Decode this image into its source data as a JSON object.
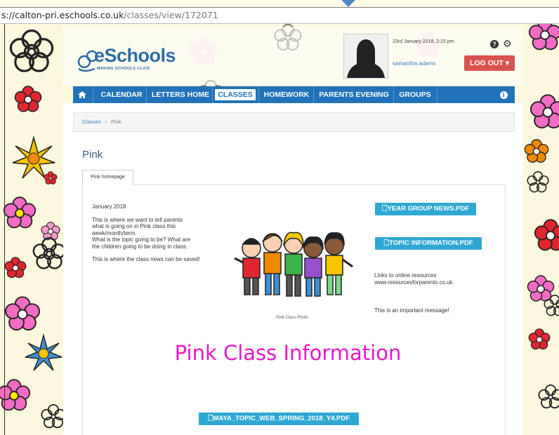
{
  "browser": {
    "url_domain": "s://calton-pri.eschools.co.uk",
    "url_path": "/classes/view/172071"
  },
  "header": {
    "logo_text": "eSchools",
    "logo_tagline": "MAKING SCHOOLS CLICK",
    "datetime": "23rd January 2018, 2:15 pm",
    "username": "samantha.adams",
    "logout_label": "LOG OUT",
    "help_icon": "question-circle-icon",
    "settings_icon": "gear-icon"
  },
  "nav": {
    "home_icon": "home-icon",
    "items": [
      "CALENDAR",
      "LETTERS HOME",
      "CLASSES",
      "HOMEWORK",
      "PARENTS EVENING",
      "GROUPS"
    ],
    "active": "CLASSES",
    "info_icon": "info-icon"
  },
  "breadcrumb": {
    "parent": "Classes",
    "separator": "»",
    "current": "Pink"
  },
  "page": {
    "title": "Pink",
    "tab_label": "Pink homepage",
    "left_column": {
      "date": "January 2018",
      "para1_line1": "This is where we want to tell parents",
      "para1_line2": "what is going on in Pink class this",
      "para1_line3": "week/month/term.",
      "para1_line4": "What is the topic going to be? What are",
      "para1_line5": "the children going to be doing in class.",
      "para2": "This is where the class news can be saved!"
    },
    "photo_caption": "Pink Class Photo",
    "buttons": {
      "year_group_news": "YEAR GROUP NEWS.PDF",
      "topic_information": "TOPIC INFORMATION.PDF",
      "maya_topic": "MAYA_TOPIC_WEB_SPRING_2018_Y4.PDF"
    },
    "links_title": "Links to online resources",
    "links_url": "www.resourcesforparents.co.uk",
    "important_message": "This is an important message!",
    "big_heading": "Pink Class Information"
  },
  "colors": {
    "brand_blue": "#2172b8",
    "logout_red": "#d9534f",
    "pdf_button": "#2ea8d2",
    "heading_pink": "#e619c6"
  }
}
